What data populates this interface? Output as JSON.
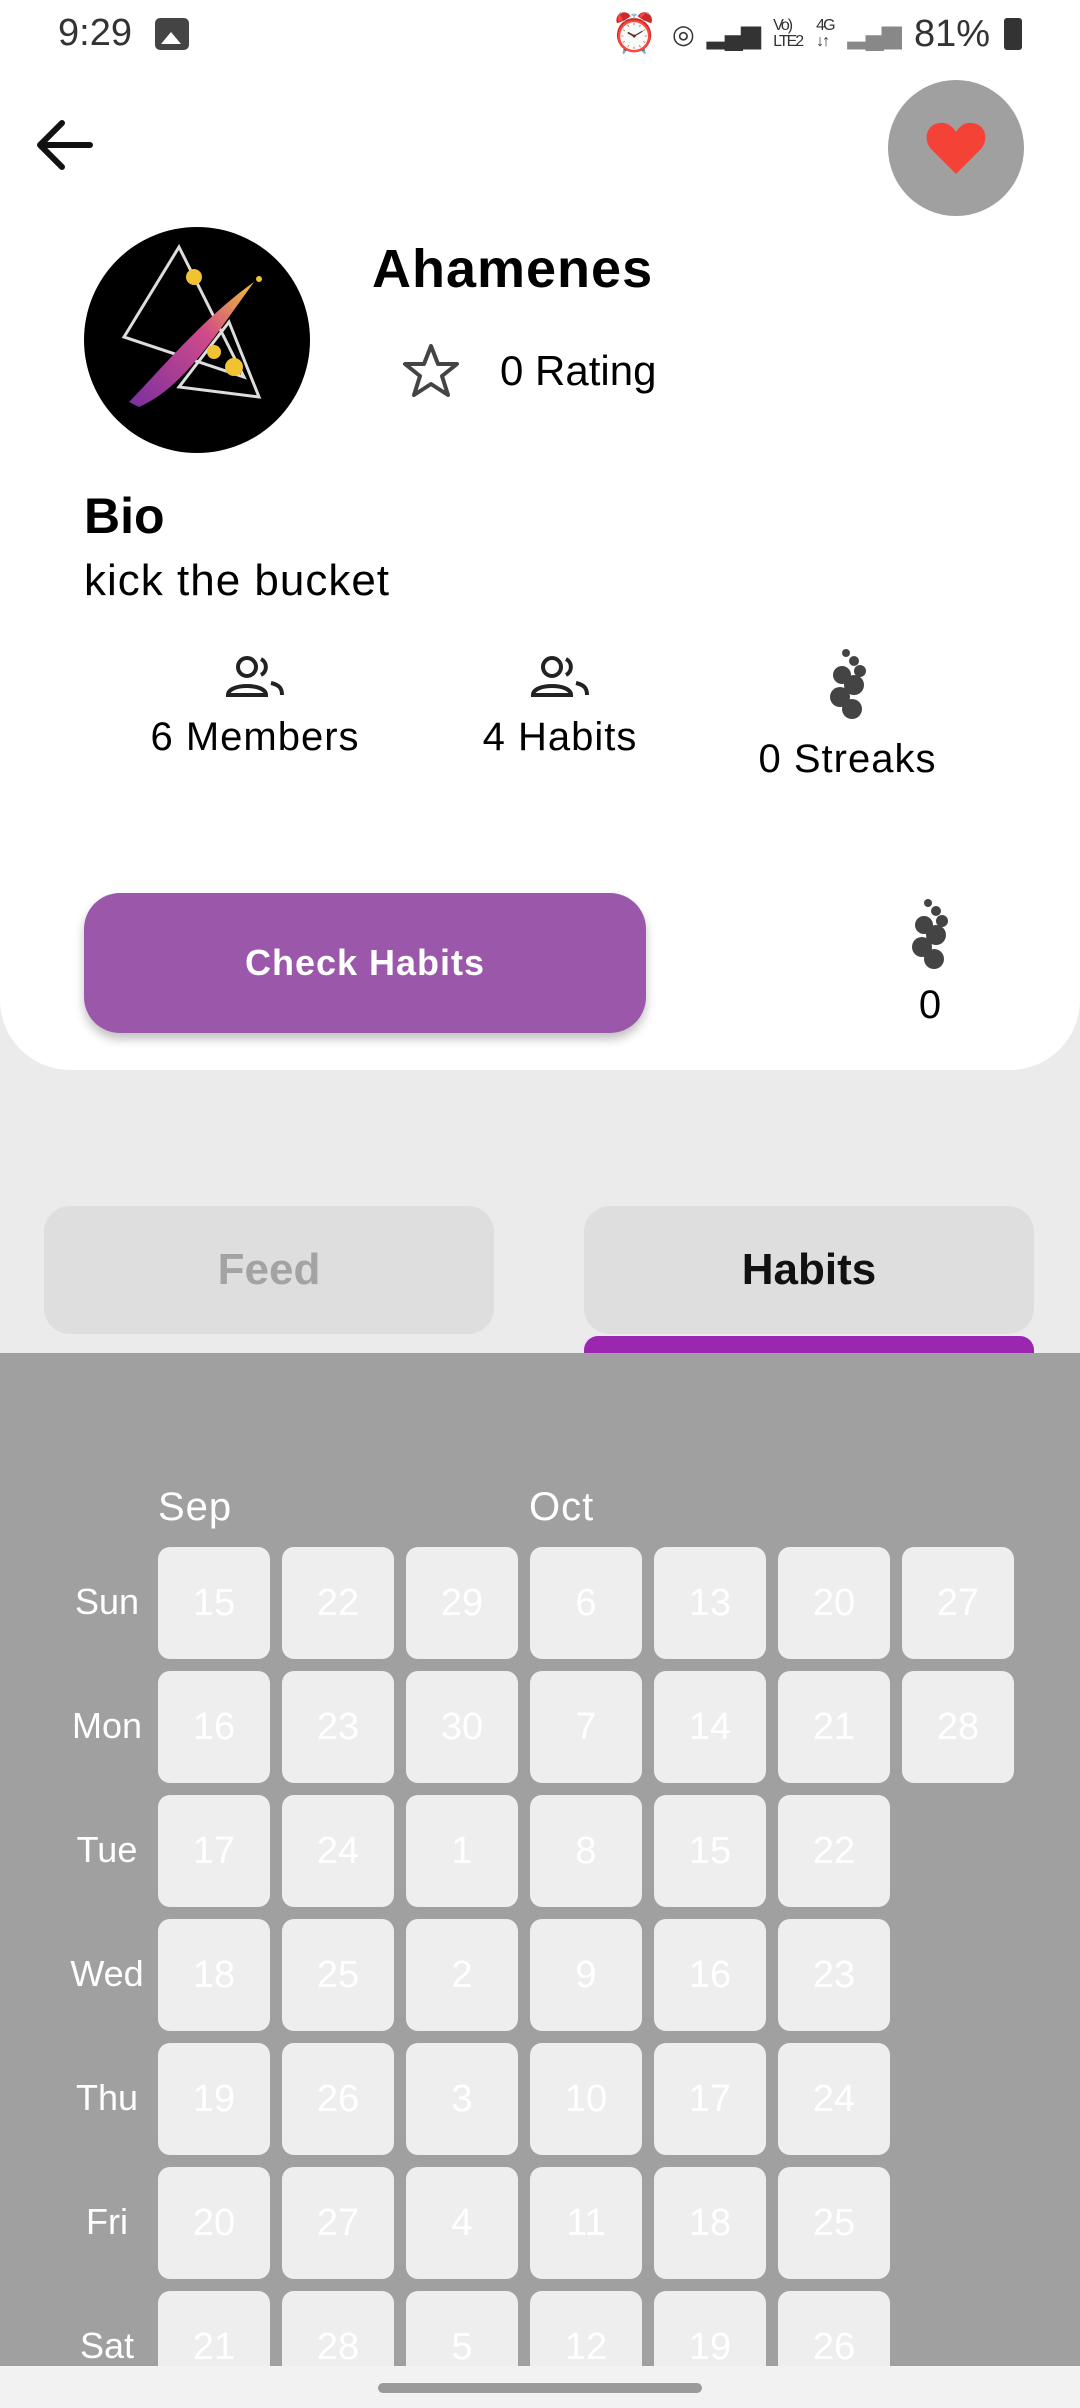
{
  "status_bar": {
    "time": "9:29",
    "battery": "81%"
  },
  "group": {
    "name": "Ahamenes",
    "rating_label": "0 Rating",
    "bio_heading": "Bio",
    "bio_text": "kick the bucket"
  },
  "stats": {
    "members_label": "6 Members",
    "habits_label": "4 Habits",
    "streaks_label": "0 Streaks"
  },
  "actions": {
    "check_habits_label": "Check Habits",
    "streak_count": "0"
  },
  "tabs": [
    {
      "label": "Feed",
      "selected": false
    },
    {
      "label": "Habits",
      "selected": true
    }
  ],
  "calendar": {
    "months": [
      "Sep",
      "Oct"
    ],
    "weekdays": [
      "Sun",
      "Mon",
      "Tue",
      "Wed",
      "Thu",
      "Fri",
      "Sat"
    ],
    "weeks": [
      [
        "15",
        "16",
        "17",
        "18",
        "19",
        "20",
        "21"
      ],
      [
        "22",
        "23",
        "24",
        "25",
        "26",
        "27",
        "28"
      ],
      [
        "29",
        "30",
        "1",
        "2",
        "3",
        "4",
        "5"
      ],
      [
        "6",
        "7",
        "8",
        "9",
        "10",
        "11",
        "12"
      ],
      [
        "13",
        "14",
        "15",
        "16",
        "17",
        "18",
        "19"
      ],
      [
        "20",
        "21",
        "22",
        "23",
        "24",
        "25",
        "26"
      ],
      [
        "27",
        "28"
      ]
    ]
  },
  "colors": {
    "accent": "#9b57a9",
    "tab_indicator": "#9b27b0",
    "heart": "#f44336",
    "calendar_bg": "#a0a0a0"
  }
}
